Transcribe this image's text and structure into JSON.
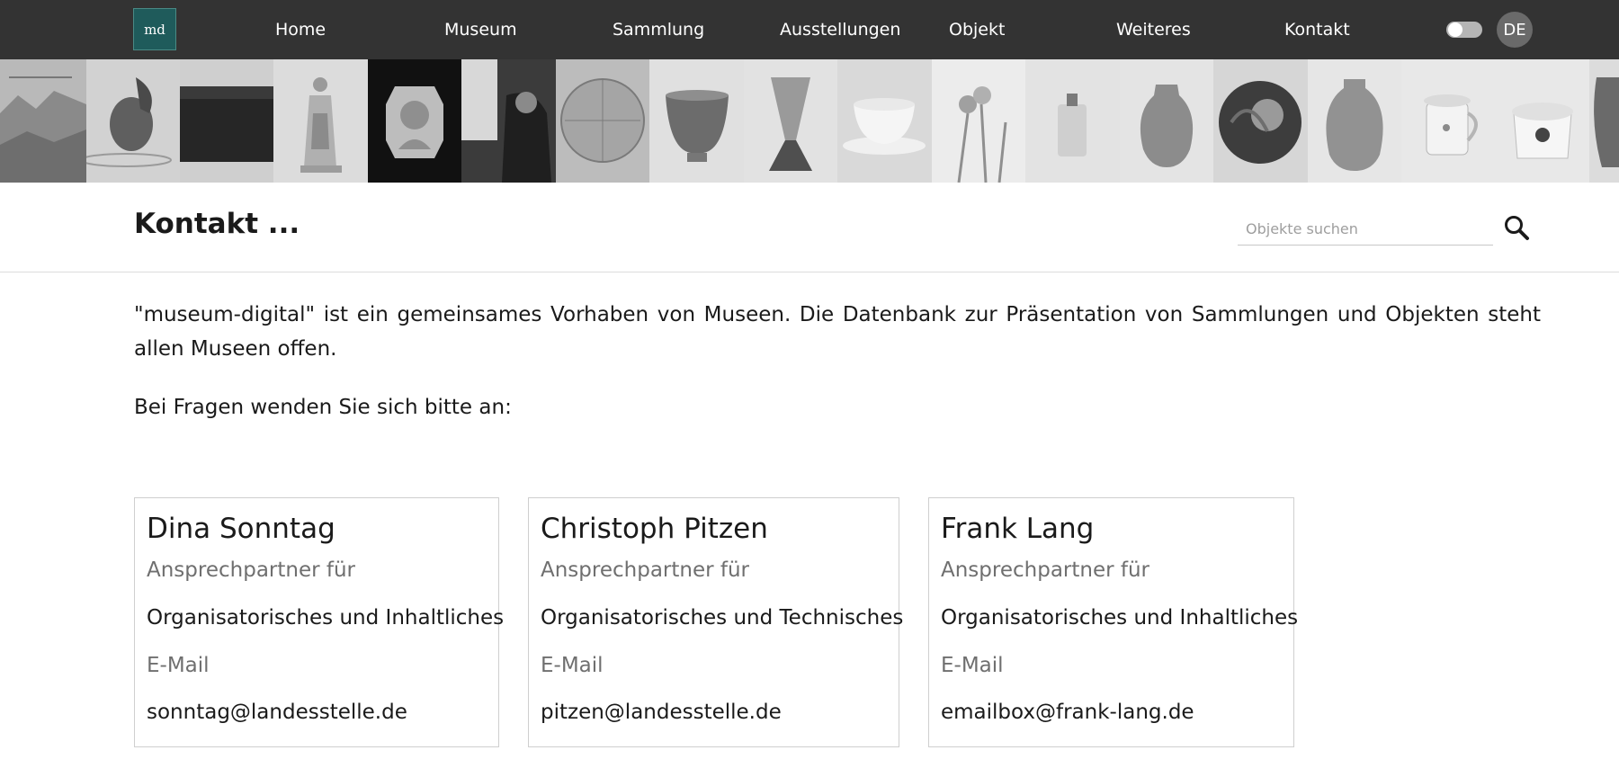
{
  "nav": {
    "logo": "md",
    "items": [
      {
        "label": "Home"
      },
      {
        "label": "Museum"
      },
      {
        "label": "Sammlung"
      },
      {
        "label": "Ausstellungen"
      },
      {
        "label": "Objekt"
      },
      {
        "label": "Weiteres"
      },
      {
        "label": "Kontakt"
      }
    ],
    "language": "DE"
  },
  "image_strip": {
    "tiles": [
      "landscape-print",
      "rooster-figure",
      "dark-box",
      "porcelain-figurine",
      "cameo-portrait",
      "photo-man-at-window",
      "round-map",
      "bowl",
      "glass-vase",
      "cup-and-saucer",
      "iris-flowers",
      "small-flask",
      "round-vase",
      "painted-sphere",
      "jar",
      "lidded-mug",
      "lidded-bowl",
      "partial-vessel"
    ]
  },
  "header": {
    "title": "Kontakt ...",
    "search_placeholder": "Objekte suchen"
  },
  "content": {
    "intro": "\"museum-digital\" ist ein gemeinsames Vorhaben von Museen. Die Datenbank zur Präsentation von Sammlungen und Objekten steht allen Museen offen.",
    "question": "Bei Fragen wenden Sie sich bitte an:"
  },
  "contacts": [
    {
      "name": "Dina Sonntag",
      "role_label": "Ansprechpartner für",
      "role_value": "Organisatorisches und Inhaltliches",
      "email_label": "E-Mail",
      "email": "sonntag@landesstelle.de"
    },
    {
      "name": "Christoph Pitzen",
      "role_label": "Ansprechpartner für",
      "role_value": "Organisatorisches und Technisches",
      "email_label": "E-Mail",
      "email": "pitzen@landesstelle.de"
    },
    {
      "name": "Frank Lang",
      "role_label": "Ansprechpartner für",
      "role_value": "Organisatorisches und Inhaltliches",
      "email_label": "E-Mail",
      "email": "emailbox@frank-lang.de"
    }
  ],
  "colors": {
    "nav_background": "#333333",
    "logo_background": "#1f5b5b",
    "muted_text": "#6f6f6f",
    "card_border": "#cfcfcf"
  }
}
